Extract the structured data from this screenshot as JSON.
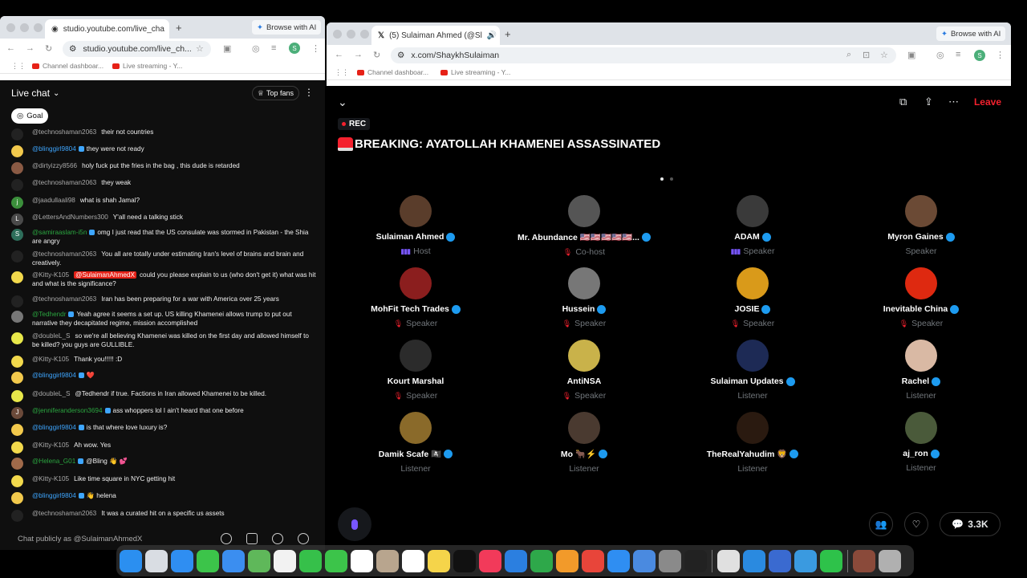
{
  "left_window": {
    "tab_title": "studio.youtube.com/live_cha",
    "browse_ai": "Browse with AI",
    "url": "studio.youtube.com/live_ch...",
    "profile_initial": "S",
    "bookmarks": [
      "Channel dashboar...",
      "Live streaming - Y..."
    ]
  },
  "chat": {
    "title": "Live chat",
    "top_fans": "Top fans",
    "goal": "Goal",
    "input_placeholder": "Chat publicly as @SulaimanAhmedX",
    "messages": [
      {
        "author": "@technoshaman2063",
        "text": "their not countries",
        "style": "",
        "avatar_color": "#222"
      },
      {
        "author": "@blinggirl9804",
        "text": "they were not ready",
        "style": "blue",
        "avatar_color": "#f2c94c"
      },
      {
        "author": "@dirtyizzy8566",
        "text": "holy fuck put the fries in the bag , this dude is retarded",
        "style": "",
        "avatar_color": "#8a5a44"
      },
      {
        "author": "@technoshaman2063",
        "text": "they weak",
        "style": "",
        "avatar_color": "#222"
      },
      {
        "author": "@jaadullaali98",
        "text": "what is shah Jamal?",
        "style": "",
        "avatar_color": "#3b8f3b",
        "initial": "j"
      },
      {
        "author": "@LettersAndNumbers300",
        "text": "Y'all need a talking stick",
        "style": "",
        "avatar_color": "#4a4a4a",
        "initial": "L"
      },
      {
        "author": "@samiraaslam-i5n",
        "text": "omg I just read that the US consulate was stormed in Pakistan - the Shia are angry",
        "style": "green",
        "avatar_color": "#2e6e5b",
        "initial": "S"
      },
      {
        "author": "@technoshaman2063",
        "text": "You all are totally under estimating Iran's level of brains and brain and creatively.",
        "style": "",
        "avatar_color": "#222"
      },
      {
        "author": "@Kitty-K105",
        "mention": "@SulaimanAhmedX",
        "text": "could you please explain to us (who don't get it) what was hit and what is the significance?",
        "style": "",
        "avatar_color": "#f2d94c"
      },
      {
        "author": "@technoshaman2063",
        "text": "Iran has been preparing for a war with America over 25 years",
        "style": "",
        "avatar_color": "#222"
      },
      {
        "author": "@Tedhendr",
        "text": "Yeah agree it seems a set up. US killing Khamenei allows trump to put out narrative they decapitated regime, mission accomplished",
        "style": "green",
        "avatar_color": "#777"
      },
      {
        "author": "@doubleL_S",
        "text": "so we're all believing Khamenei was killed on the first day and allowed himself to be killed? you guys are GULLIBLE.",
        "style": "",
        "avatar_color": "#e8e84a"
      },
      {
        "author": "@Kitty-K105",
        "text": "Thank you!!!!! :D",
        "style": "",
        "avatar_color": "#f2d94c"
      },
      {
        "author": "@blinggirl9804",
        "text": "❤️",
        "style": "blue",
        "avatar_color": "#f2c94c"
      },
      {
        "author": "@doubleL_S",
        "text": "@Tedhendr if true. Factions in Iran allowed Khamenei to be killed.",
        "style": "",
        "avatar_color": "#e8e84a"
      },
      {
        "author": "@jenniferanderson3694",
        "text": "ass whoppers lol I ain't heard that one before",
        "style": "green",
        "avatar_color": "#6b4a3a",
        "initial": "J"
      },
      {
        "author": "@blinggirl9804",
        "text": "is that where love luxury is?",
        "style": "blue",
        "avatar_color": "#f2c94c"
      },
      {
        "author": "@Kitty-K105",
        "text": "Ah wow. Yes",
        "style": "",
        "avatar_color": "#f2d94c"
      },
      {
        "author": "@Helena_G01",
        "text": "@Bling 👋 💕",
        "style": "green",
        "avatar_color": "#a06a4a"
      },
      {
        "author": "@Kitty-K105",
        "text": "Like time square in NYC getting hit",
        "style": "",
        "avatar_color": "#f2d94c"
      },
      {
        "author": "@blinggirl9804",
        "text": "👋 helena",
        "style": "blue",
        "avatar_color": "#f2c94c"
      },
      {
        "author": "@technoshaman2063",
        "text": "It was a curated hit on a specific us assets",
        "style": "",
        "avatar_color": "#222"
      }
    ]
  },
  "right_window": {
    "tab_title": "(5) Sulaiman Ahmed (@Sl",
    "browse_ai": "Browse with AI",
    "url": "x.com/ShaykhSulaiman",
    "profile_initial": "S",
    "bookmarks": [
      "Channel dashboar...",
      "Live streaming - Y..."
    ]
  },
  "space": {
    "rec": "REC",
    "title": "BREAKING: AYATOLLAH KHAMENEI ASSASSINATED",
    "leave": "Leave",
    "listener_count": "3.3K",
    "participants": [
      {
        "name": "Sulaiman Ahmed",
        "role": "Host",
        "verified": true,
        "indicator": "bars",
        "color": "#5a3d2b"
      },
      {
        "name": "Mr. Abundance 🇺🇸🇺🇸🇺🇸🇺🇸🇺🇸...",
        "role": "Co-host",
        "verified": true,
        "indicator": "mute",
        "color": "#555"
      },
      {
        "name": "ADAM",
        "role": "Speaker",
        "verified": true,
        "indicator": "bars",
        "color": "#3a3a3a"
      },
      {
        "name": "Myron Gaines",
        "role": "Speaker",
        "verified": true,
        "indicator": "",
        "color": "#6b4a35"
      },
      {
        "name": "MohFit Tech Trades",
        "role": "Speaker",
        "verified": true,
        "indicator": "mute",
        "color": "#8b1e1e"
      },
      {
        "name": "Hussein",
        "role": "Speaker",
        "verified": true,
        "indicator": "mute",
        "color": "#777"
      },
      {
        "name": "JOSIE",
        "role": "Speaker",
        "verified": true,
        "indicator": "mute",
        "color": "#d99a1a"
      },
      {
        "name": "Inevitable China",
        "role": "Speaker",
        "verified": true,
        "indicator": "mute",
        "color": "#de2910"
      },
      {
        "name": "Kourt Marshal",
        "role": "Speaker",
        "verified": false,
        "indicator": "mute",
        "color": "#2b2b2b"
      },
      {
        "name": "AntiNSA",
        "role": "Speaker",
        "verified": false,
        "indicator": "mute",
        "color": "#c9b24a"
      },
      {
        "name": "Sulaiman Updates",
        "role": "Listener",
        "verified": true,
        "indicator": "",
        "color": "#1d2a55"
      },
      {
        "name": "Rachel",
        "role": "Listener",
        "verified": true,
        "indicator": "",
        "color": "#d9b9a4"
      },
      {
        "name": "Damik Scafe 🏴‍☠️",
        "role": "Listener",
        "verified": true,
        "indicator": "",
        "color": "#8a6a2a"
      },
      {
        "name": "Mo 🐂⚡",
        "role": "Listener",
        "verified": true,
        "indicator": "",
        "color": "#4a3a30"
      },
      {
        "name": "TheRealYahudim 🦁",
        "role": "Listener",
        "verified": true,
        "indicator": "",
        "color": "#2a1a10"
      },
      {
        "name": "aj_ron",
        "role": "Listener",
        "verified": true,
        "indicator": "",
        "color": "#4a5a3a"
      }
    ]
  },
  "dock": {
    "apps": [
      "finder-icon",
      "launchpad-icon",
      "safari-icon",
      "messages-icon",
      "mail-icon",
      "maps-icon",
      "photos-icon",
      "facetime-icon",
      "phone-icon",
      "calendar-icon",
      "contacts-icon",
      "reminders-icon",
      "notes-icon",
      "appletv-icon",
      "music-icon",
      "keynote-icon",
      "numbers-icon",
      "pages-icon",
      "rocket-icon",
      "appstore-icon",
      "preview-icon",
      "settings-icon",
      "activity-icon",
      "chrome-icon",
      "edge-icon",
      "finder2-icon",
      "quicktime-icon",
      "whatsapp-icon",
      "photobooth-icon",
      "trash-icon"
    ],
    "colors": [
      "#2b8ff0",
      "#d9dde3",
      "#2f8ef2",
      "#3cc44a",
      "#3b8ef0",
      "#5fb85a",
      "#f2f2f2",
      "#36c04a",
      "#3cc44a",
      "#ffffff",
      "#b8a58e",
      "#ffffff",
      "#f5d44a",
      "#111111",
      "#f23a5a",
      "#2b7fe0",
      "#2ea84a",
      "#f29a2a",
      "#e8453a",
      "#2f8ef2",
      "#4a8ae0",
      "#8a8a8a",
      "#222222",
      "#e0e0e0",
      "#2a8ae0",
      "#3a6ad0",
      "#3a9ae0",
      "#2ec24a",
      "#8a4a3a",
      "#b0b0b0"
    ]
  }
}
